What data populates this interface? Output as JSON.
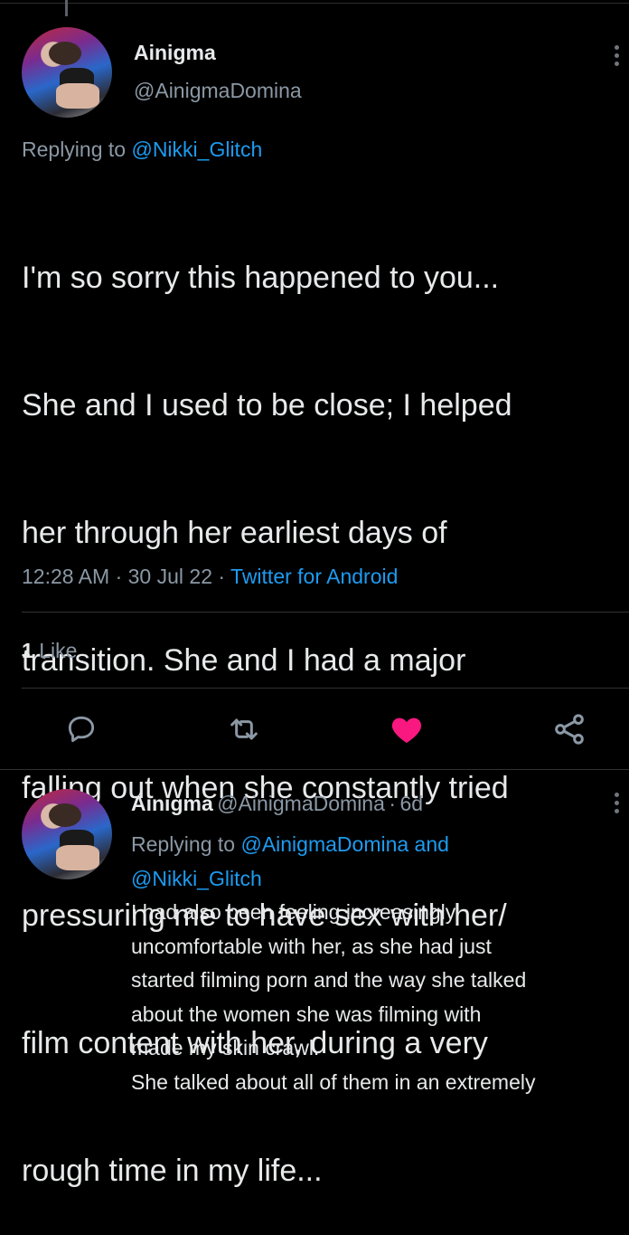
{
  "tweet": {
    "author_name": "Ainigma",
    "author_handle": "@AinigmaDomina",
    "replying_prefix": "Replying to ",
    "replying_to": "@Nikki_Glitch",
    "text_lines": [
      "I'm so sorry this happened to you...",
      "She and I used to be close; I helped",
      "her through her earliest days of",
      "transition. She and I had a major",
      "falling out when she constantly tried",
      "pressuring me to have sex with her/",
      "film content with her, during a very",
      "rough time in my life..."
    ],
    "time": "12:28 AM",
    "date": "30 Jul 22",
    "dot": "·",
    "source": "Twitter for Android",
    "like_count": "1",
    "like_label": "Like"
  },
  "actions": {
    "reply_icon": "reply-icon",
    "retweet_icon": "retweet-icon",
    "like_icon": "heart-icon",
    "share_icon": "share-icon",
    "like_color": "#f91880"
  },
  "reply": {
    "author_name": "Ainigma",
    "author_handle": "@AinigmaDomina",
    "dot": "·",
    "age": "6d",
    "replying_prefix": "Replying to ",
    "replying_to_1": "@AinigmaDomina",
    "and": " and",
    "replying_to_2": "@Nikki_Glitch",
    "text_lines": [
      "I had also been feeling increasingly",
      "uncomfortable with her, as she had just",
      "started filming porn and the way she talked",
      "about the women she was filming with",
      "made my skin crawl.",
      "She talked about all of them in an extremely"
    ]
  },
  "colors": {
    "background": "#000000",
    "accent": "#1d9bf0",
    "muted": "#8b98a5"
  }
}
